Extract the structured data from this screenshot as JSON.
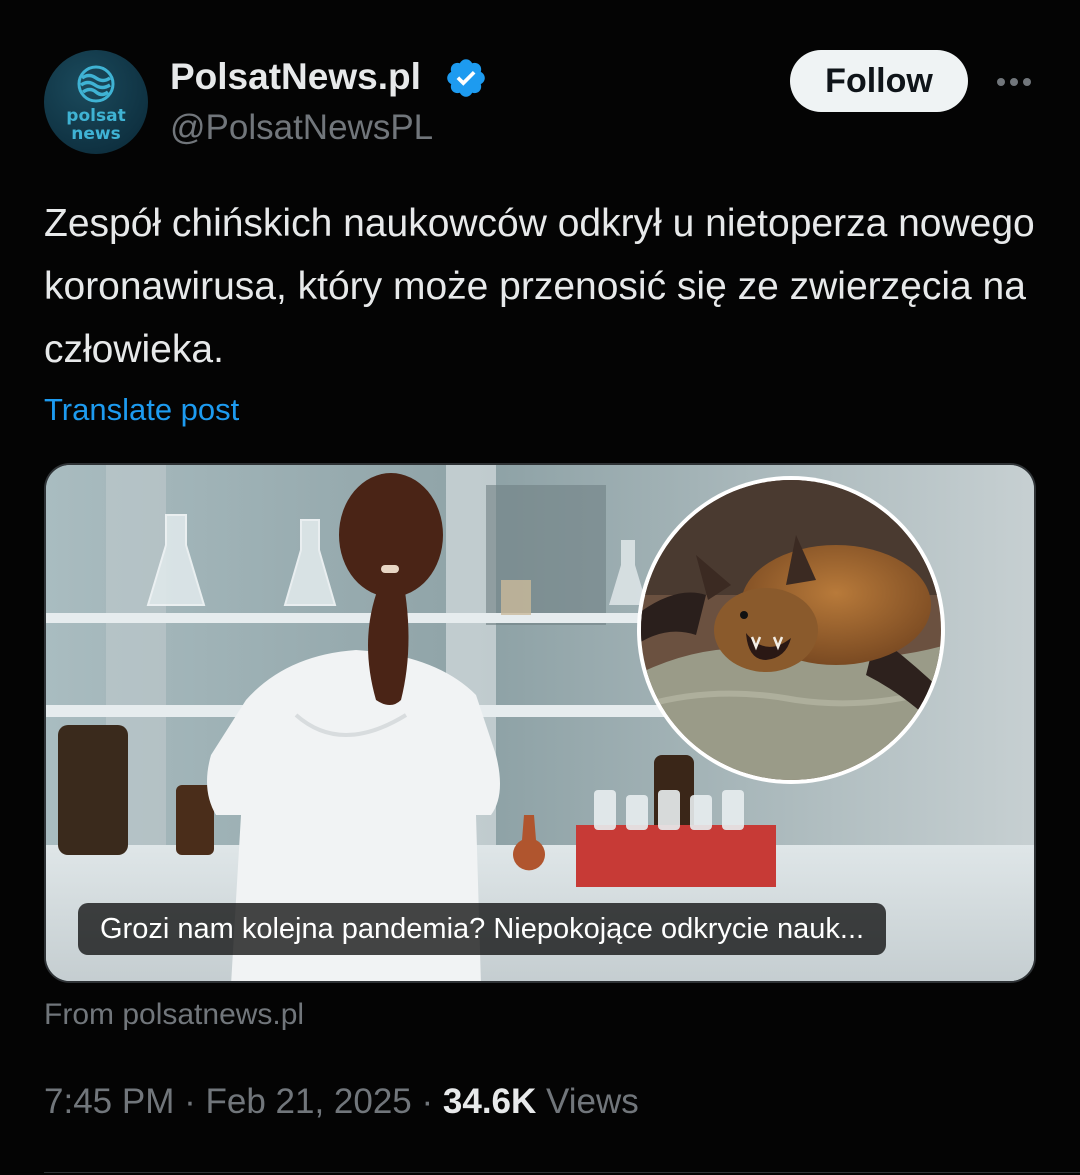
{
  "author": {
    "display_name": "PolsatNews.pl",
    "handle": "@PolsatNewsPL",
    "verified": true,
    "avatar_text_line1": "polsat",
    "avatar_text_line2": "news"
  },
  "follow_label": "Follow",
  "more_icon": "more-horizontal-icon",
  "tweet": {
    "text": "Zespół chińskich naukowców odkrył u nietoperza nowego koronawirusa, który może przenosić się ze zwierzęcia na człowieka.",
    "translate_label": "Translate post"
  },
  "card": {
    "caption": "Grozi nam kolejna pandemia? Niepokojące odkrycie nauk...",
    "source": "From polsatnews.pl"
  },
  "meta": {
    "time": "7:45 PM",
    "separator": "·",
    "date": "Feb 21, 2025",
    "views_count": "34.6K",
    "views_label": "Views"
  },
  "colors": {
    "background": "#040404",
    "text": "#e7e9ea",
    "secondary": "#71767b",
    "link": "#1d9bf0",
    "verified": "#1d9bf0"
  }
}
